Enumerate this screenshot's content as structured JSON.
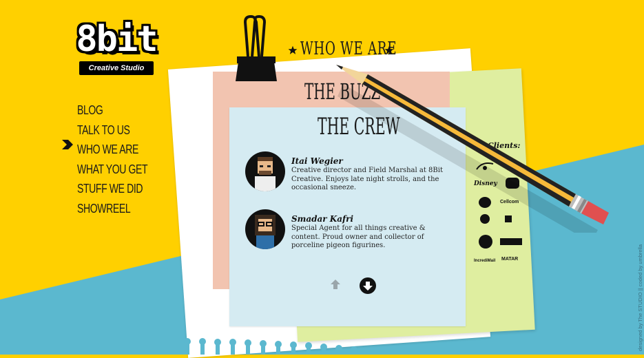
{
  "brand": {
    "logo_text": "8bit",
    "logo_sub": "Creative Studio"
  },
  "nav": {
    "items": [
      {
        "label": "BLOG"
      },
      {
        "label": "TALK TO US"
      },
      {
        "label": "WHO WE ARE",
        "active": true
      },
      {
        "label": "WHAT YOU GET"
      },
      {
        "label": "STUFF WE DID"
      },
      {
        "label": "SHOWREEL"
      }
    ]
  },
  "pages": {
    "who_title": "WHO WE ARE",
    "buzz_title": "THE BUZZ",
    "crew_title": "THE CREW"
  },
  "crew": [
    {
      "name": "Itai Wegier",
      "desc": "Creative director and Field Marshal at 8Bit Creative. Enjoys late night strolls, and the occasional sneeze."
    },
    {
      "name": "Smadar Kafri",
      "desc": "Special Agent for all things creative & content. Proud owner and collector of porceline pigeon figurines."
    }
  ],
  "clients": {
    "title": "Clients:",
    "logos": [
      "Disney",
      "Cellcom",
      "IncrediMail",
      "MATAR"
    ]
  },
  "footer": {
    "credit": "designed by The STUDIO || coded by umbrella"
  },
  "colors": {
    "yellow": "#ffd000",
    "blue": "#5bb8cf",
    "pink": "#f2c4b0",
    "paper_blue": "#d5ebf2",
    "green": "#dfeea0"
  },
  "icons": [
    "binder-clip-icon",
    "pencil-icon",
    "star-icon",
    "arrow-right-icon",
    "arrow-up-icon",
    "arrow-down-icon"
  ]
}
